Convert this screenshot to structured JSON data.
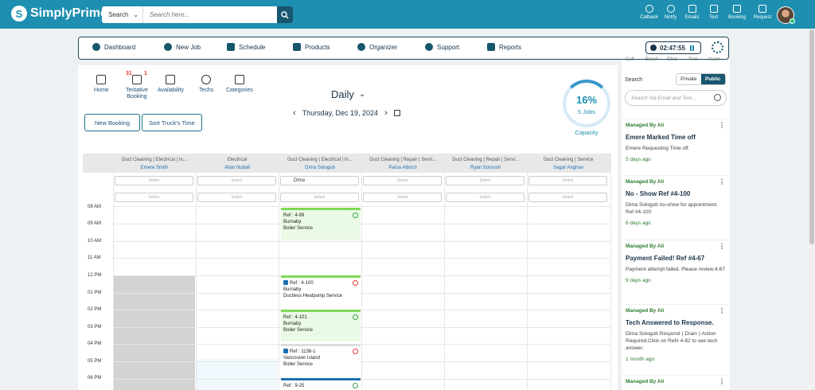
{
  "brand": {
    "name": "SimplyPrime"
  },
  "search": {
    "scope": "Search",
    "placeholder": "Search here..."
  },
  "top_actions": [
    {
      "label": "Callback",
      "icon": "phone-icon"
    },
    {
      "label": "Notify",
      "icon": "bell-icon"
    },
    {
      "label": "Emails",
      "icon": "mail-icon"
    },
    {
      "label": "Text",
      "icon": "chat-icon"
    },
    {
      "label": "Booking",
      "icon": "calendar-icon"
    },
    {
      "label": "Request",
      "icon": "request-icon"
    }
  ],
  "nav": {
    "items": [
      "Dashboard",
      "New Job",
      "Schedule",
      "Products",
      "Organizer",
      "Support",
      "Reports"
    ],
    "timer": "02:47:55"
  },
  "tools": [
    {
      "label": "Home"
    },
    {
      "label": "Tentative Booking",
      "badge_left": "31",
      "badge_right": "1"
    },
    {
      "label": "Availability"
    },
    {
      "label": "Techs"
    },
    {
      "label": "Categories"
    }
  ],
  "buttons": {
    "new_booking": "New Booking",
    "sort_time": "Sort Truck's Time"
  },
  "view": {
    "mode": "Daily",
    "date": "Thursday, Dec 19, 2024"
  },
  "capacity": {
    "percent": "16%",
    "jobs": "5 Jobs",
    "label": "Capacity",
    "fraction": 0.16
  },
  "columns": [
    {
      "category": "Duct Cleaning | Electrical | In...",
      "tech": "Emere Smith",
      "select1": "Select",
      "select2": "Select"
    },
    {
      "category": "Electrical",
      "tech": "Allan Nuttall",
      "select1": "Select",
      "select2": "Select"
    },
    {
      "category": "Duct Cleaning | Electrical | In...",
      "tech": "Dima Sologub",
      "select1": "Dima",
      "select2": "Select"
    },
    {
      "category": "Duct Cleaning | Repair | Servi...",
      "tech": "Parsa Alborzi",
      "select1": "Select",
      "select2": "Select"
    },
    {
      "category": "Duct Cleaning | Repair | Servi...",
      "tech": "Ryan Soroush",
      "select1": "Select",
      "select2": "Select"
    },
    {
      "category": "Duct Cleaning | Service",
      "tech": "Sagar Anghan",
      "select1": "Select",
      "select2": "Select"
    }
  ],
  "times": [
    "08 AM",
    "09 AM",
    "10 AM",
    "11 AM",
    "12 PM",
    "01 PM",
    "02 PM",
    "03 PM",
    "04 PM",
    "05 PM",
    "06 PM"
  ],
  "jobs": [
    {
      "ref": "Ref : 4-99",
      "city": "Burnaby",
      "service": "Boiler Service"
    },
    {
      "ref": "Ref : 4-100",
      "city": "Burnaby",
      "service": "Ductless Heatpump Service"
    },
    {
      "ref": "Ref : 4-101",
      "city": "Burnaby",
      "service": "Boiler Service"
    },
    {
      "ref": "Ref : 1136-1",
      "city": "Vancouver Island",
      "service": "Boiler Service"
    },
    {
      "ref": "Ref : 9-25",
      "city": "",
      "service": ""
    }
  ],
  "right_panel": {
    "tabs": [
      "Call",
      "Email",
      "Chat",
      "Text",
      "Alarm"
    ],
    "search_label": "Search",
    "toggle": {
      "private": "Private",
      "public": "Public"
    },
    "search_placeholder": "Search Via Email and Text...",
    "cards": [
      {
        "managed": "Managed By Ali",
        "title": "Emere Marked Time off",
        "desc": "Emere Requesting Time off.",
        "ago": "5 days ago"
      },
      {
        "managed": "Managed By Ali",
        "title": "No - Show Ref #4-100",
        "desc": "Dima Sologub no-show for appointment. Ref #4-100",
        "ago": "6 days ago"
      },
      {
        "managed": "Managed By Ali",
        "title": "Payment Failed! Ref #4-67",
        "desc": "Payment attempt failed. Please review.4-67",
        "ago": "9 days ago"
      },
      {
        "managed": "Managed By Ali",
        "title": "Tech Answered to Response.",
        "desc": "Dima Sologub Respond ( Drain ) Action Required.Click on Ref# 4-82 to see tech answer.",
        "ago": "1 month ago"
      },
      {
        "managed": "Managed By Ali",
        "title": "",
        "desc": "",
        "ago": ""
      }
    ]
  }
}
